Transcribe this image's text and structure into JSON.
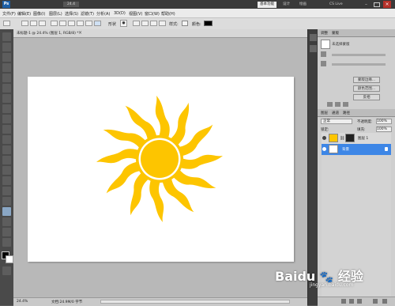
{
  "app": {
    "logo": "Ps",
    "zoom": "24.4",
    "workspace_buttons": [
      "基本功能",
      "设计",
      "绘画"
    ],
    "cslive": "CS Live"
  },
  "menu": [
    "文件(F)",
    "编辑(E)",
    "图像(I)",
    "图层(L)",
    "选择(S)",
    "滤镜(T)",
    "分析(A)",
    "3D(D)",
    "视图(V)",
    "窗口(W)",
    "帮助(H)"
  ],
  "options": {
    "shape_label": "形状",
    "style_label": "样式:",
    "color_label": "颜色:"
  },
  "document": {
    "tab_title": "未标题-1 @ 24.4% (图层 1, RGB/8) *",
    "zoom_status": "24.4%",
    "doc_status": "文档:24.9M/0 字节"
  },
  "adjust_panel": {
    "tab_a": "调整",
    "tab_b": "蒙版",
    "preset_label": "未选择蒙版",
    "btn_1": "蒙版边缘...",
    "btn_2": "颜色范围...",
    "btn_3": "反相"
  },
  "layers_panel": {
    "tabs": [
      "图层",
      "通道",
      "路径"
    ],
    "blend_mode": "正常",
    "opacity_label": "不透明度:",
    "opacity_value": "100%",
    "lock_label": "锁定:",
    "fill_label": "填充:",
    "fill_value": "100%",
    "layers": [
      {
        "name": "图层 1",
        "selected": false
      },
      {
        "name": "背景",
        "selected": true
      }
    ]
  },
  "colors": {
    "sun": "#FDC500",
    "accent": "#3d86e6",
    "selected_row": "#3d86e6",
    "foreground": "#000000",
    "background": "#ffffff"
  },
  "watermark": {
    "text": "Baidu",
    "text_cn": "经验",
    "url": "jingyan.baidu.com"
  }
}
